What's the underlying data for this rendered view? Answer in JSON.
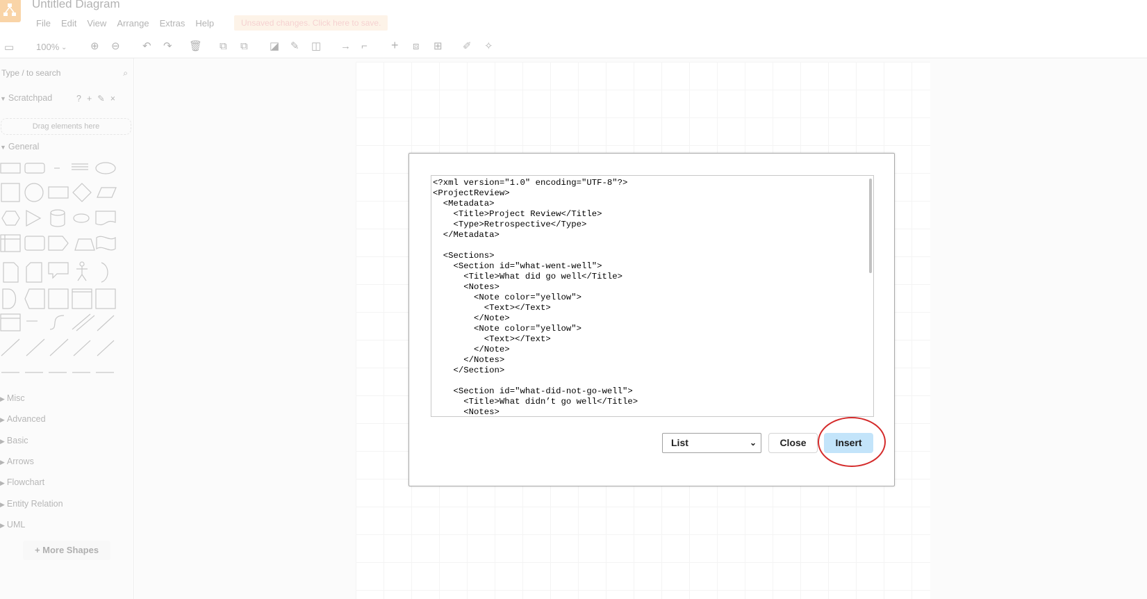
{
  "header": {
    "title": "Untitled Diagram",
    "menu": [
      "File",
      "Edit",
      "View",
      "Arrange",
      "Extras",
      "Help"
    ],
    "unsaved": "Unsaved changes. Click here to save."
  },
  "toolbar": {
    "zoom": "100%"
  },
  "sidebar": {
    "search_placeholder": "Type / to search",
    "scratchpad": "Scratchpad",
    "scratchpad_drop": "Drag elements here",
    "general": "General",
    "sections": [
      "Misc",
      "Advanced",
      "Basic",
      "Arrows",
      "Flowchart",
      "Entity Relation",
      "UML"
    ],
    "more_shapes": "+ More Shapes"
  },
  "dialog": {
    "code": "<?xml version=\"1.0\" encoding=\"UTF-8\"?>\n<ProjectReview>\n  <Metadata>\n    <Title>Project Review</Title>\n    <Type>Retrospective</Type>\n  </Metadata>\n\n  <Sections>\n    <Section id=\"what-went-well\">\n      <Title>What did go well</Title>\n      <Notes>\n        <Note color=\"yellow\">\n          <Text></Text>\n        </Note>\n        <Note color=\"yellow\">\n          <Text></Text>\n        </Note>\n      </Notes>\n    </Section>\n\n    <Section id=\"what-did-not-go-well\">\n      <Title>What didn’t go well</Title>\n      <Notes>",
    "format_selected": "List",
    "close_label": "Close",
    "insert_label": "Insert"
  },
  "colors": {
    "insert_bg": "#c3e4fa",
    "highlight": "#d42a2a",
    "logo": "#f08705"
  }
}
